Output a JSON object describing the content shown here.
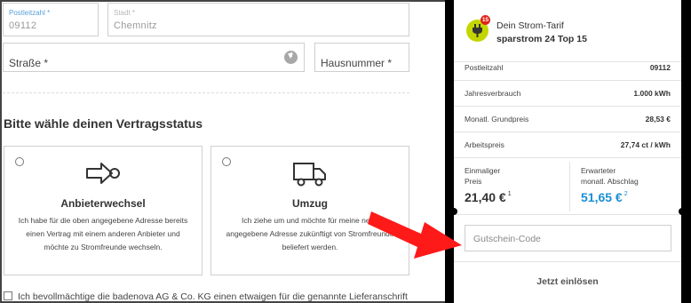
{
  "address": {
    "postal_code_label": "Postleitzahl *",
    "postal_code_value": "09112",
    "city_label": "Stadt *",
    "city_value": "Chemnitz",
    "street_placeholder": "Straße *",
    "house_number_placeholder": "Hausnummer *"
  },
  "contract_status": {
    "title": "Bitte wähle deinen Vertragsstatus",
    "options": [
      {
        "icon": "provider-switch-icon",
        "title": "Anbieterwechsel",
        "text": "Ich habe für die oben angegebene Adresse bereits einen Vertrag mit einem anderen Anbieter und möchte zu Stromfreunde wechseln."
      },
      {
        "icon": "truck-icon",
        "title": "Umzug",
        "text": "Ich ziehe um und möchte für meine neue angegebene Adresse zukünftigt von Stromfreunde beliefert werden."
      }
    ]
  },
  "consent": {
    "text": "Ich bevollmächtige die badenova AG & Co. KG einen etwaigen für die genannte Lieferanschrift"
  },
  "summary": {
    "badge": "15",
    "tariff_label": "Dein Strom-Tarif",
    "tariff_name": "sparstrom 24 Top 15",
    "rows": [
      {
        "label": "Postleitzahl",
        "value": "09112"
      },
      {
        "label": "Jahresverbrauch",
        "value": "1.000 kWh"
      },
      {
        "label": "Monatl. Grundpreis",
        "value": "28,53 €"
      },
      {
        "label": "Arbeitspreis",
        "value": "27,74 ct / kWh"
      }
    ],
    "one_time_label_1": "Einmaliger",
    "one_time_label_2": "Preis",
    "one_time_value": "21,40 €",
    "one_time_footnote": "1",
    "expected_label_1": "Erwarteter",
    "expected_label_2": "monatl. Abschlag",
    "expected_value": "51,65 €",
    "expected_footnote": "2",
    "voucher_placeholder": "Gutschein-Code",
    "redeem_label": "Jetzt einlösen"
  },
  "colors": {
    "label_blue": "#5aa0d8",
    "price_blue": "#1a8fd6",
    "tariff_green": "#c4d600",
    "badge_red": "#e2231a",
    "annotation_arrow": "#ff1a1a"
  }
}
